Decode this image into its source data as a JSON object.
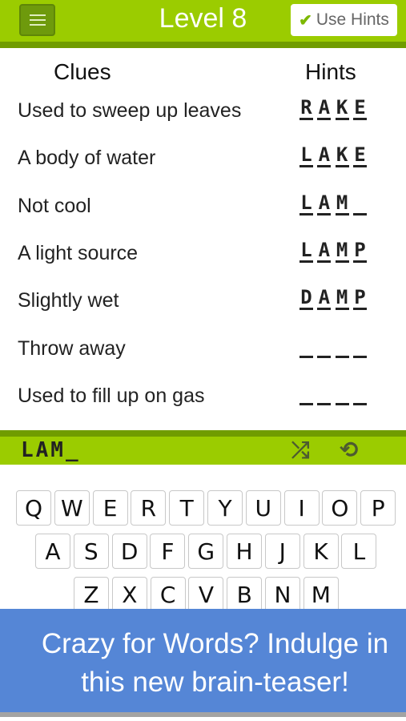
{
  "header": {
    "title": "Level 8",
    "use_hints_label": "Use Hints"
  },
  "columns": {
    "clues": "Clues",
    "hints": "Hints"
  },
  "rows": [
    {
      "clue": "Used to sweep up leaves",
      "hint": [
        "R",
        "A",
        "K",
        "E"
      ]
    },
    {
      "clue": "A body of water",
      "hint": [
        "L",
        "A",
        "K",
        "E"
      ]
    },
    {
      "clue": "Not cool",
      "hint": [
        "L",
        "A",
        "M",
        ""
      ]
    },
    {
      "clue": "A light source",
      "hint": [
        "L",
        "A",
        "M",
        "P"
      ]
    },
    {
      "clue": "Slightly wet",
      "hint": [
        "D",
        "A",
        "M",
        "P"
      ]
    },
    {
      "clue": "Throw away",
      "hint": [
        "",
        "",
        "",
        ""
      ]
    },
    {
      "clue": "Used to fill up on gas",
      "hint": [
        "",
        "",
        "",
        ""
      ]
    }
  ],
  "input": {
    "current": "LAM_"
  },
  "keyboard": [
    [
      "Q",
      "W",
      "E",
      "R",
      "T",
      "Y",
      "U",
      "I",
      "O",
      "P"
    ],
    [
      "A",
      "S",
      "D",
      "F",
      "G",
      "H",
      "J",
      "K",
      "L"
    ],
    [
      "Z",
      "X",
      "C",
      "V",
      "B",
      "N",
      "M"
    ]
  ],
  "banner": {
    "line1": "Crazy for Words? Indulge in",
    "line2": "this new brain-teaser!"
  },
  "colors": {
    "green": "#9bcc00",
    "dark_green": "#709c00",
    "banner_blue": "#5586d6"
  }
}
